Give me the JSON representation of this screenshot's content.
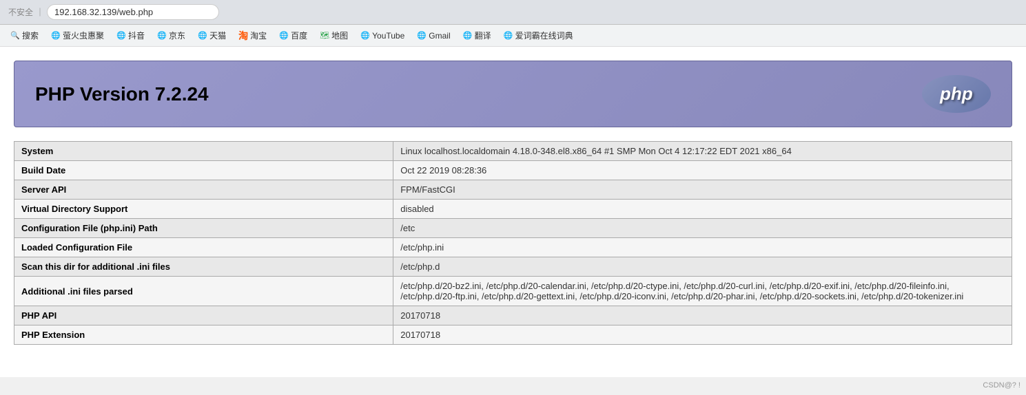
{
  "browser": {
    "security_text": "不安全",
    "separator": "｜",
    "url": "192.168.32.139/web.php"
  },
  "bookmarks": [
    {
      "id": "search",
      "label": "搜索",
      "icon": "🔍",
      "icon_type": "search"
    },
    {
      "id": "huochong",
      "label": "萤火虫惠聚",
      "icon": "🌐",
      "icon_type": "globe"
    },
    {
      "id": "douyin",
      "label": "抖音",
      "icon": "🌐",
      "icon_type": "globe"
    },
    {
      "id": "jingdong",
      "label": "京东",
      "icon": "🌐",
      "icon_type": "globe"
    },
    {
      "id": "tianmao",
      "label": "天猫",
      "icon": "🌐",
      "icon_type": "globe"
    },
    {
      "id": "taobao",
      "label": "淘宝",
      "icon": "🛒",
      "icon_type": "taobao"
    },
    {
      "id": "baidu",
      "label": "百度",
      "icon": "🌐",
      "icon_type": "globe"
    },
    {
      "id": "map",
      "label": "地图",
      "icon": "📍",
      "icon_type": "map"
    },
    {
      "id": "youtube",
      "label": "YouTube",
      "icon": "▶",
      "icon_type": "youtube"
    },
    {
      "id": "gmail",
      "label": "Gmail",
      "icon": "🌐",
      "icon_type": "globe"
    },
    {
      "id": "translate",
      "label": "翻译",
      "icon": "🌐",
      "icon_type": "globe"
    },
    {
      "id": "aicidian",
      "label": "爱词霸在线词典",
      "icon": "🌐",
      "icon_type": "globe"
    }
  ],
  "phpinfo": {
    "title": "PHP Version 7.2.24",
    "logo_text": "php",
    "rows": [
      {
        "key": "System",
        "value": "Linux localhost.localdomain 4.18.0-348.el8.x86_64 #1 SMP Mon Oct 4 12:17:22 EDT 2021 x86_64"
      },
      {
        "key": "Build Date",
        "value": "Oct 22 2019 08:28:36"
      },
      {
        "key": "Server API",
        "value": "FPM/FastCGI"
      },
      {
        "key": "Virtual Directory Support",
        "value": "disabled"
      },
      {
        "key": "Configuration File (php.ini) Path",
        "value": "/etc"
      },
      {
        "key": "Loaded Configuration File",
        "value": "/etc/php.ini"
      },
      {
        "key": "Scan this dir for additional .ini files",
        "value": "/etc/php.d"
      },
      {
        "key": "Additional .ini files parsed",
        "value": "/etc/php.d/20-bz2.ini, /etc/php.d/20-calendar.ini, /etc/php.d/20-ctype.ini, /etc/php.d/20-curl.ini, /etc/php.d/20-exif.ini, /etc/php.d/20-fileinfo.ini, /etc/php.d/20-ftp.ini, /etc/php.d/20-gettext.ini, /etc/php.d/20-iconv.ini, /etc/php.d/20-phar.ini, /etc/php.d/20-sockets.ini, /etc/php.d/20-tokenizer.ini"
      },
      {
        "key": "PHP API",
        "value": "20170718"
      },
      {
        "key": "PHP Extension",
        "value": "20170718"
      }
    ]
  },
  "watermark": "CSDN@? !"
}
